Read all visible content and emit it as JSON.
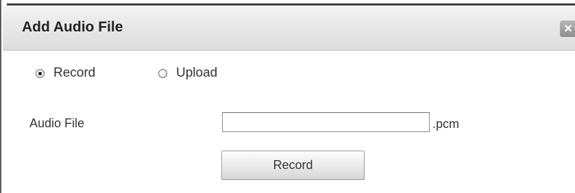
{
  "dialog": {
    "title": "Add Audio File",
    "close_glyph": "×",
    "close_icon": "close-icon"
  },
  "mode": {
    "options": [
      {
        "label": "Record",
        "selected": true
      },
      {
        "label": "Upload",
        "selected": false
      }
    ]
  },
  "form": {
    "audio_file_label": "Audio File",
    "audio_file_value": "",
    "extension": ".pcm",
    "record_button_label": "Record"
  }
}
